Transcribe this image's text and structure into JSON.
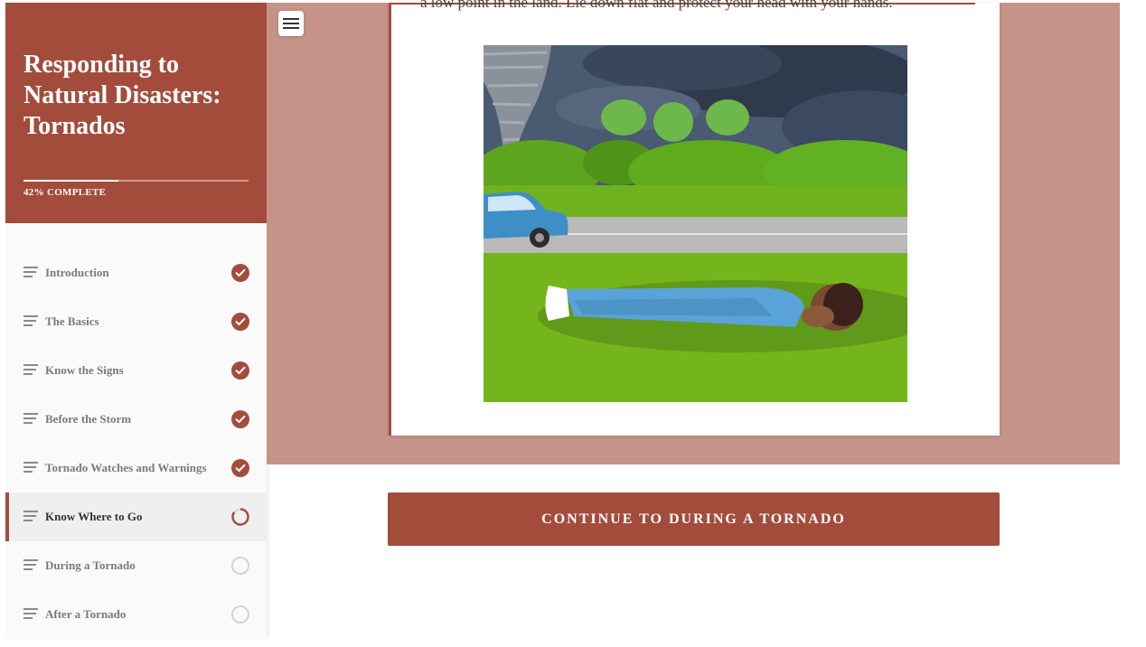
{
  "course": {
    "title": "Responding to Natural Disasters: Tornados",
    "progress_percent": 42,
    "progress_label": "42% COMPLETE"
  },
  "lessons": [
    {
      "label": "Introduction",
      "status": "complete"
    },
    {
      "label": "The Basics",
      "status": "complete"
    },
    {
      "label": "Know the Signs",
      "status": "complete"
    },
    {
      "label": "Before the Storm",
      "status": "complete"
    },
    {
      "label": "Tornado Watches and Warnings",
      "status": "complete"
    },
    {
      "label": "Know Where to Go",
      "status": "in-progress"
    },
    {
      "label": "During a Tornado",
      "status": "not-started"
    },
    {
      "label": "After a Tornado",
      "status": "not-started"
    }
  ],
  "content": {
    "body_text": "a low point in the land. Lie down flat and protect your head with your hands."
  },
  "continue_button": {
    "label": "CONTINUE TO DURING A TORNADO"
  },
  "icons": {
    "menu": "hamburger-menu-icon",
    "lesson": "lines-icon",
    "complete": "check-circle-icon",
    "in_progress": "partial-circle-icon",
    "not_started": "empty-circle-icon"
  },
  "colors": {
    "accent": "#a34c3c",
    "band": "#c69389"
  }
}
